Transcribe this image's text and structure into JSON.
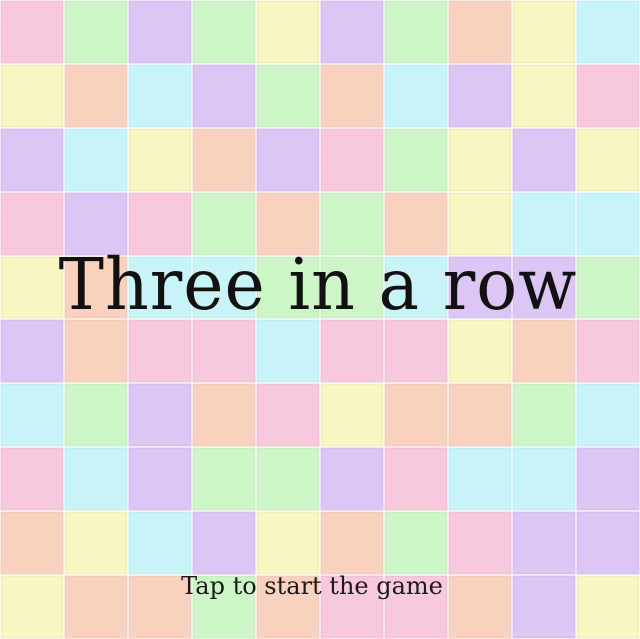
{
  "game": {
    "title": "Three in a row",
    "start_hint": "Tap to start the game"
  },
  "palette": {
    "pink": "#f8c8dc",
    "green": "#cef5c8",
    "purple": "#dcc6f6",
    "yellow": "#f8f6c2",
    "peach": "#f8d2be",
    "cyan": "#c8f4f8"
  },
  "board": {
    "rows": 10,
    "cols": 10,
    "tiles": [
      [
        "pink",
        "green",
        "purple",
        "green",
        "yellow",
        "purple",
        "green",
        "peach",
        "yellow",
        "cyan"
      ],
      [
        "yellow",
        "peach",
        "cyan",
        "purple",
        "green",
        "peach",
        "cyan",
        "purple",
        "yellow",
        "pink"
      ],
      [
        "purple",
        "cyan",
        "yellow",
        "peach",
        "purple",
        "pink",
        "green",
        "yellow",
        "purple",
        "yellow"
      ],
      [
        "pink",
        "purple",
        "pink",
        "green",
        "peach",
        "green",
        "peach",
        "yellow",
        "cyan",
        "cyan"
      ],
      [
        "yellow",
        "peach",
        "cyan",
        "cyan",
        "green",
        "green",
        "cyan",
        "purple",
        "purple",
        "green"
      ],
      [
        "purple",
        "peach",
        "pink",
        "pink",
        "cyan",
        "pink",
        "pink",
        "yellow",
        "peach",
        "pink"
      ],
      [
        "cyan",
        "green",
        "purple",
        "peach",
        "pink",
        "yellow",
        "peach",
        "peach",
        "green",
        "cyan"
      ],
      [
        "pink",
        "cyan",
        "purple",
        "green",
        "green",
        "purple",
        "pink",
        "cyan",
        "cyan",
        "purple"
      ],
      [
        "peach",
        "yellow",
        "cyan",
        "purple",
        "yellow",
        "peach",
        "green",
        "pink",
        "purple",
        "purple"
      ],
      [
        "yellow",
        "peach",
        "peach",
        "green",
        "peach",
        "pink",
        "pink",
        "peach",
        "purple",
        "yellow"
      ]
    ]
  }
}
